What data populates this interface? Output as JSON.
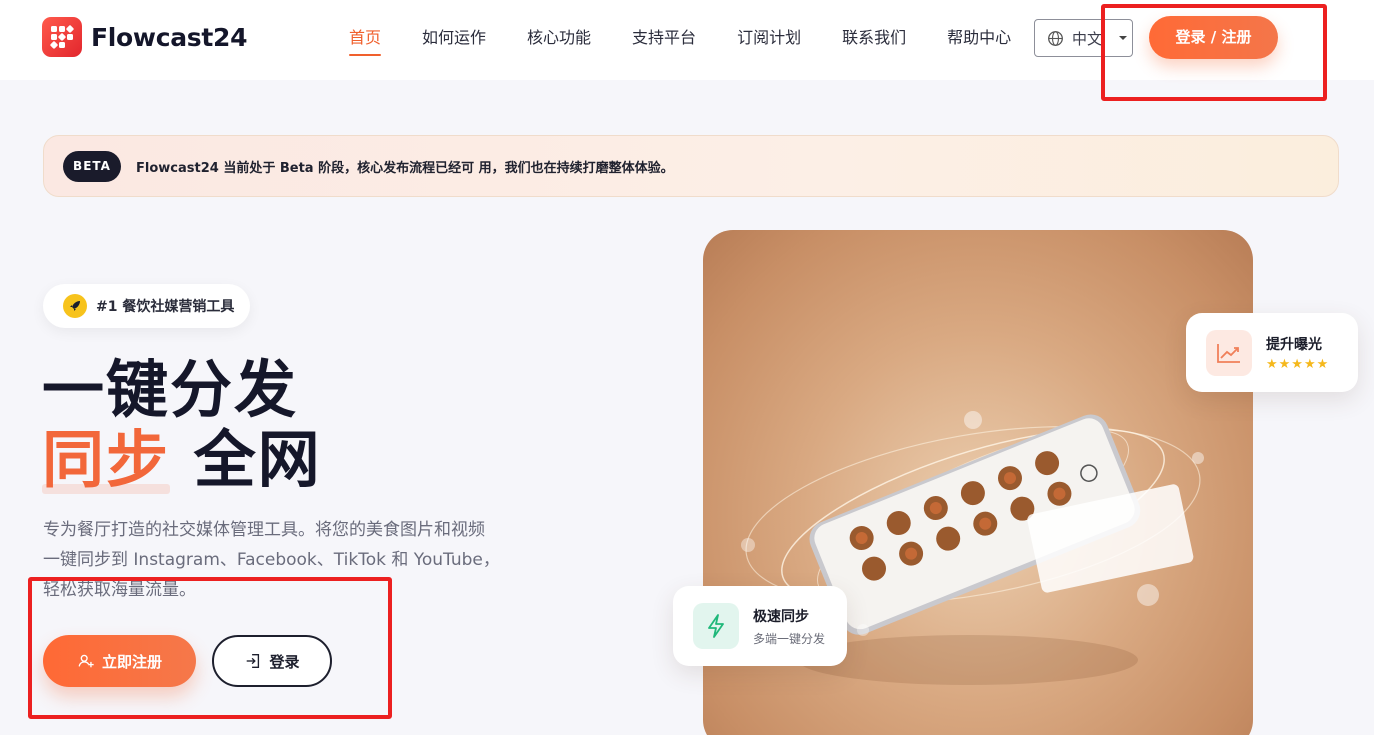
{
  "header": {
    "brand": "Flowcast24",
    "nav": [
      {
        "label": "首页",
        "active": true
      },
      {
        "label": "如何运作",
        "active": false
      },
      {
        "label": "核心功能",
        "active": false
      },
      {
        "label": "支持平台",
        "active": false
      },
      {
        "label": "订阅计划",
        "active": false
      },
      {
        "label": "联系我们",
        "active": false
      },
      {
        "label": "帮助中心",
        "active": false
      }
    ],
    "language": "中文",
    "login_register": "登录 / 注册"
  },
  "beta_banner": {
    "badge": "BETA",
    "text": "Flowcast24 当前处于 Beta 阶段，核心发布流程已经可 用，我们也在持续打磨整体体验。"
  },
  "hero": {
    "tagline": "#1 餐饮社媒营销工具",
    "title_line1": "一键分发",
    "title_line2_accent": "同步",
    "title_line2_rest": " 全网",
    "description_lines": [
      "专为餐厅打造的社交媒体管理工具。将您的美食图片和视频",
      "一键同步到 Instagram、Facebook、TikTok 和 YouTube，",
      "轻松获取海量流量。"
    ],
    "register_button": "立即注册",
    "login_button": "登录"
  },
  "cards": {
    "exposure": {
      "title": "提升曝光",
      "stars": "★★★★★"
    },
    "sync": {
      "title": "极速同步",
      "subtitle": "多端一键分发"
    }
  },
  "colors": {
    "accent": "#f0602d",
    "dark": "#1a1b2b",
    "annotation": "#ec2020"
  }
}
